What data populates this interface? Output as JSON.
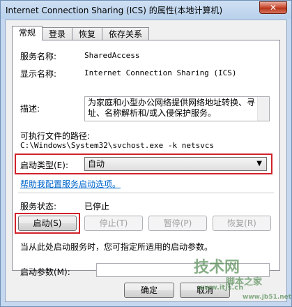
{
  "window": {
    "title": "Internet Connection Sharing (ICS) 的属性(本地计算机)",
    "close_glyph": "✕"
  },
  "tabs": [
    {
      "label": "常规"
    },
    {
      "label": "登录"
    },
    {
      "label": "恢复"
    },
    {
      "label": "依存关系"
    }
  ],
  "general": {
    "service_name_label": "服务名称:",
    "service_name_value": "SharedAccess",
    "display_name_label": "显示名称:",
    "display_name_value": "Internet Connection Sharing (ICS)",
    "description_label": "描述:",
    "description_value": "为家庭和小型办公网络提供网络地址转换、寻址、名称解析和/或入侵保护服务。",
    "exe_path_label": "可执行文件的路径:",
    "exe_path_value": "C:\\Windows\\System32\\svchost.exe -k netsvcs",
    "startup_type_label": "启动类型(E):",
    "startup_type_value": "自动",
    "help_link": "帮助我配置服务启动选项。",
    "status_label": "服务状态:",
    "status_value": "已停止",
    "start_button": "启动(S)",
    "stop_button": "停止(T)",
    "pause_button": "暂停(P)",
    "resume_button": "恢复(R)",
    "hint_text": "当从此处启动服务时，您可指定所适用的启动参数。",
    "params_label": "启动参数(M):",
    "params_value": ""
  },
  "footer": {
    "ok_button": "确定",
    "cancel_button": "取消"
  },
  "watermark": {
    "line1": "技术网",
    "line2": "脚本之家",
    "line3": "www.itjs.cn",
    "line4": "www.jb51.net"
  },
  "colors": {
    "highlight_red": "#d1222a",
    "link_blue": "#0066cc"
  }
}
